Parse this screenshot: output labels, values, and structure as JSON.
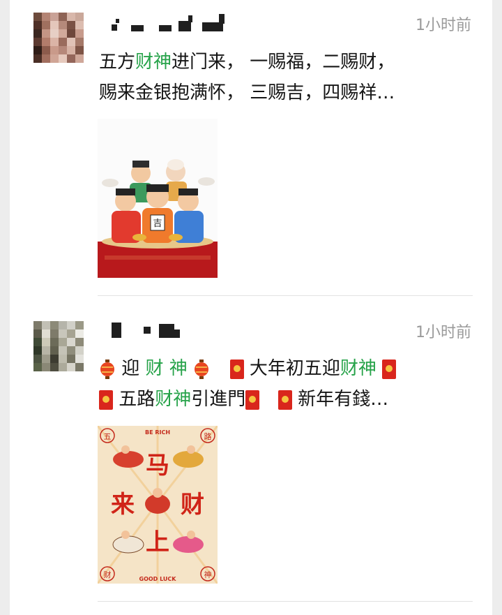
{
  "posts": [
    {
      "time": "1小时前",
      "line1": {
        "a": "五方",
        "b": "财神",
        "c": "进门来，  一赐福，二赐财，"
      },
      "line2": "赐来金银抱满怀，  三赐吉，四赐祥…",
      "image_icon": "gods-of-wealth-illustration",
      "image_tile": "吉"
    },
    {
      "time": "1小时前",
      "line1": {
        "a": "迎 ",
        "b": "财 神",
        "c": " 大年初五迎",
        "d": "财神"
      },
      "line2": {
        "a": "五路",
        "b": "财神",
        "c": "引進門",
        "d": "新年有錢…"
      },
      "image_icon": "ma-lai-cai-poster",
      "poster": {
        "top": "BE RICH",
        "bottom": "GOOD LUCK",
        "c1": "马",
        "c2": "来",
        "c3": "财",
        "c4": "上",
        "corner_tl": "五",
        "corner_tr": "路",
        "corner_bl": "财",
        "corner_br": "神"
      }
    }
  ],
  "colors": {
    "highlight": "#27a34a",
    "time": "#9a9a9a",
    "background": "#ededed"
  }
}
